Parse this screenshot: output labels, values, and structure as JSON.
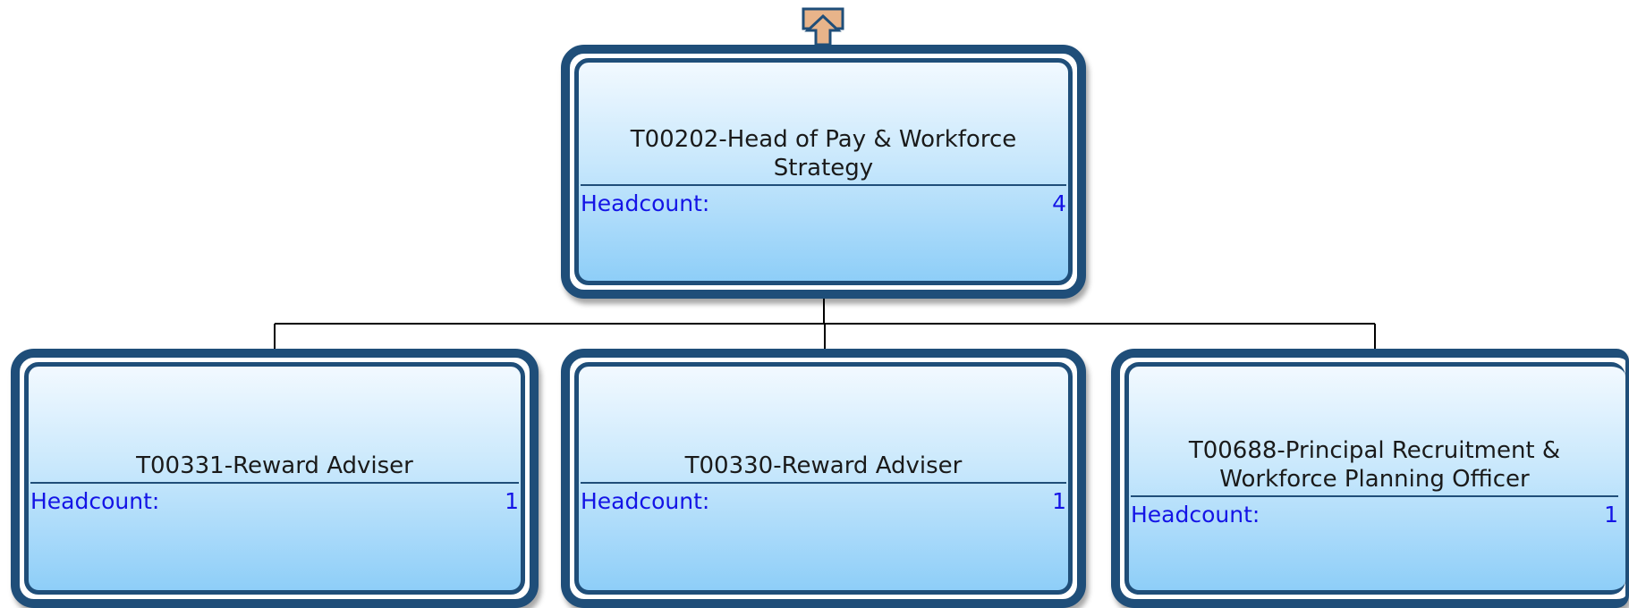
{
  "colors": {
    "node_border": "#1f4e79",
    "node_gradient_top": "#f2f9ff",
    "node_gradient_bottom": "#8ecef8",
    "headcount_text": "#1414e6",
    "connector": "#000000",
    "up_button_fill": "#e8b48a"
  },
  "navigation": {
    "up_icon": "up-arrow-icon"
  },
  "root": {
    "title": "T00202-Head of Pay & Workforce Strategy",
    "headcount_label": "Headcount:",
    "headcount_value": "4"
  },
  "children": [
    {
      "title": "T00331-Reward Adviser",
      "headcount_label": "Headcount:",
      "headcount_value": "1"
    },
    {
      "title": "T00330-Reward Adviser",
      "headcount_label": "Headcount:",
      "headcount_value": "1"
    },
    {
      "title": "T00688-Principal Recruitment & Workforce Planning Officer",
      "headcount_label": "Headcount:",
      "headcount_value": "1"
    }
  ]
}
